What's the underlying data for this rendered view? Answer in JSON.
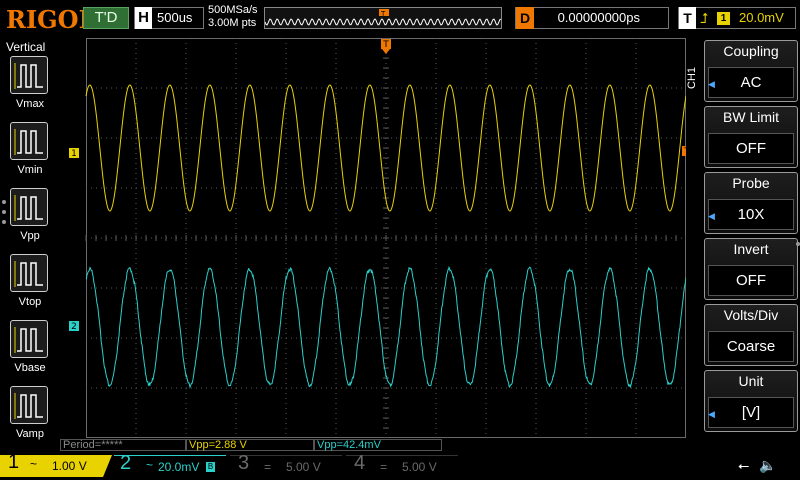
{
  "topbar": {
    "brand": "RIGOL",
    "trigger_status": "T'D",
    "horizontal": {
      "label": "H",
      "timebase": "500us"
    },
    "sample_rate": "500MSa/s",
    "memory_depth": "3.00M pts",
    "delay": {
      "label": "D",
      "value": "0.00000000ps"
    },
    "trigger": {
      "label": "T",
      "edge_icon": "rising-edge-icon",
      "source": "1",
      "level": "20.0mV"
    }
  },
  "left_menu": {
    "title": "Vertical",
    "items": [
      {
        "label": "Vmax",
        "icon": "vmax-icon"
      },
      {
        "label": "Vmin",
        "icon": "vmin-icon"
      },
      {
        "label": "Vpp",
        "icon": "vpp-icon"
      },
      {
        "label": "Vtop",
        "icon": "vtop-icon"
      },
      {
        "label": "Vbase",
        "icon": "vbase-icon"
      },
      {
        "label": "Vamp",
        "icon": "vamp-icon"
      }
    ]
  },
  "right_menu": {
    "channel_tag": "CH1",
    "items": [
      {
        "label": "Coupling",
        "value": "AC",
        "has_arrow": true
      },
      {
        "label": "BW Limit",
        "value": "OFF",
        "has_arrow": false
      },
      {
        "label": "Probe",
        "value": "10X",
        "has_arrow": true
      },
      {
        "label": "Invert",
        "value": "OFF",
        "has_arrow": false
      },
      {
        "label": "Volts/Div",
        "value": "Coarse",
        "has_arrow": false
      },
      {
        "label": "Unit",
        "value": "[V]",
        "has_arrow": true
      }
    ]
  },
  "screen": {
    "ch1_marker": "1",
    "ch2_marker": "2",
    "trigger_marker": "T",
    "trigger_pos_marker": "T",
    "colors": {
      "ch1": "#e8d300",
      "ch2": "#2bd0c9",
      "grid": "#5a5a5a",
      "marker": "#f07800"
    }
  },
  "waveforms": {
    "ch1": {
      "cycles_visible": 15,
      "shape": "sine"
    },
    "ch2": {
      "cycles_visible": 15,
      "shape": "sine"
    }
  },
  "measurements": [
    {
      "text": "Period=*****",
      "color": "#8a8a8a"
    },
    {
      "text": "Vpp=2.88 V",
      "color": "#e8d300"
    },
    {
      "text": "Vpp=42.4mV",
      "color": "#2bd0c9"
    }
  ],
  "channels": [
    {
      "number": "1",
      "coupling": "~",
      "scale": "1.00 V",
      "active": true
    },
    {
      "number": "2",
      "coupling": "~",
      "scale": "20.0mV",
      "bw_badge": "B",
      "active": true
    },
    {
      "number": "3",
      "coupling": "=",
      "scale": "5.00 V",
      "active": false
    },
    {
      "number": "4",
      "coupling": "=",
      "scale": "5.00 V",
      "active": false
    }
  ],
  "system": {
    "usb_icon": "usb-icon",
    "sound_icon": "sound-muted-icon",
    "usb_glyph": "⭠",
    "sound_glyph": "🔈"
  }
}
